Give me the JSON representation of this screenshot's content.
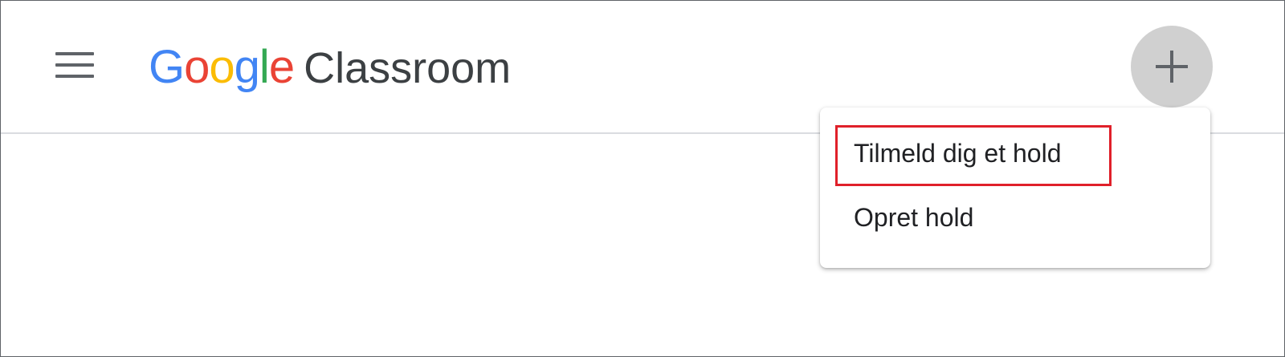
{
  "header": {
    "logo": {
      "letters": [
        {
          "char": "G",
          "color": "#4285F4"
        },
        {
          "char": "o",
          "color": "#EA4335"
        },
        {
          "char": "o",
          "color": "#FBBC05"
        },
        {
          "char": "g",
          "color": "#4285F4"
        },
        {
          "char": "l",
          "color": "#34A853"
        },
        {
          "char": "e",
          "color": "#EA4335"
        }
      ]
    },
    "product_name": "Classroom",
    "menu_icon": "hamburger-menu-icon",
    "add_icon": "plus-icon"
  },
  "menu": {
    "items": [
      {
        "label": "Tilmeld dig et hold",
        "highlighted": true
      },
      {
        "label": "Opret hold",
        "highlighted": false
      }
    ]
  },
  "colors": {
    "text_primary": "#202124",
    "product_text": "#3c4043",
    "icon_gray": "#5f6368",
    "add_button_bg": "#d0d0d0",
    "highlight_border": "#e0202a",
    "divider": "#dadce0"
  }
}
